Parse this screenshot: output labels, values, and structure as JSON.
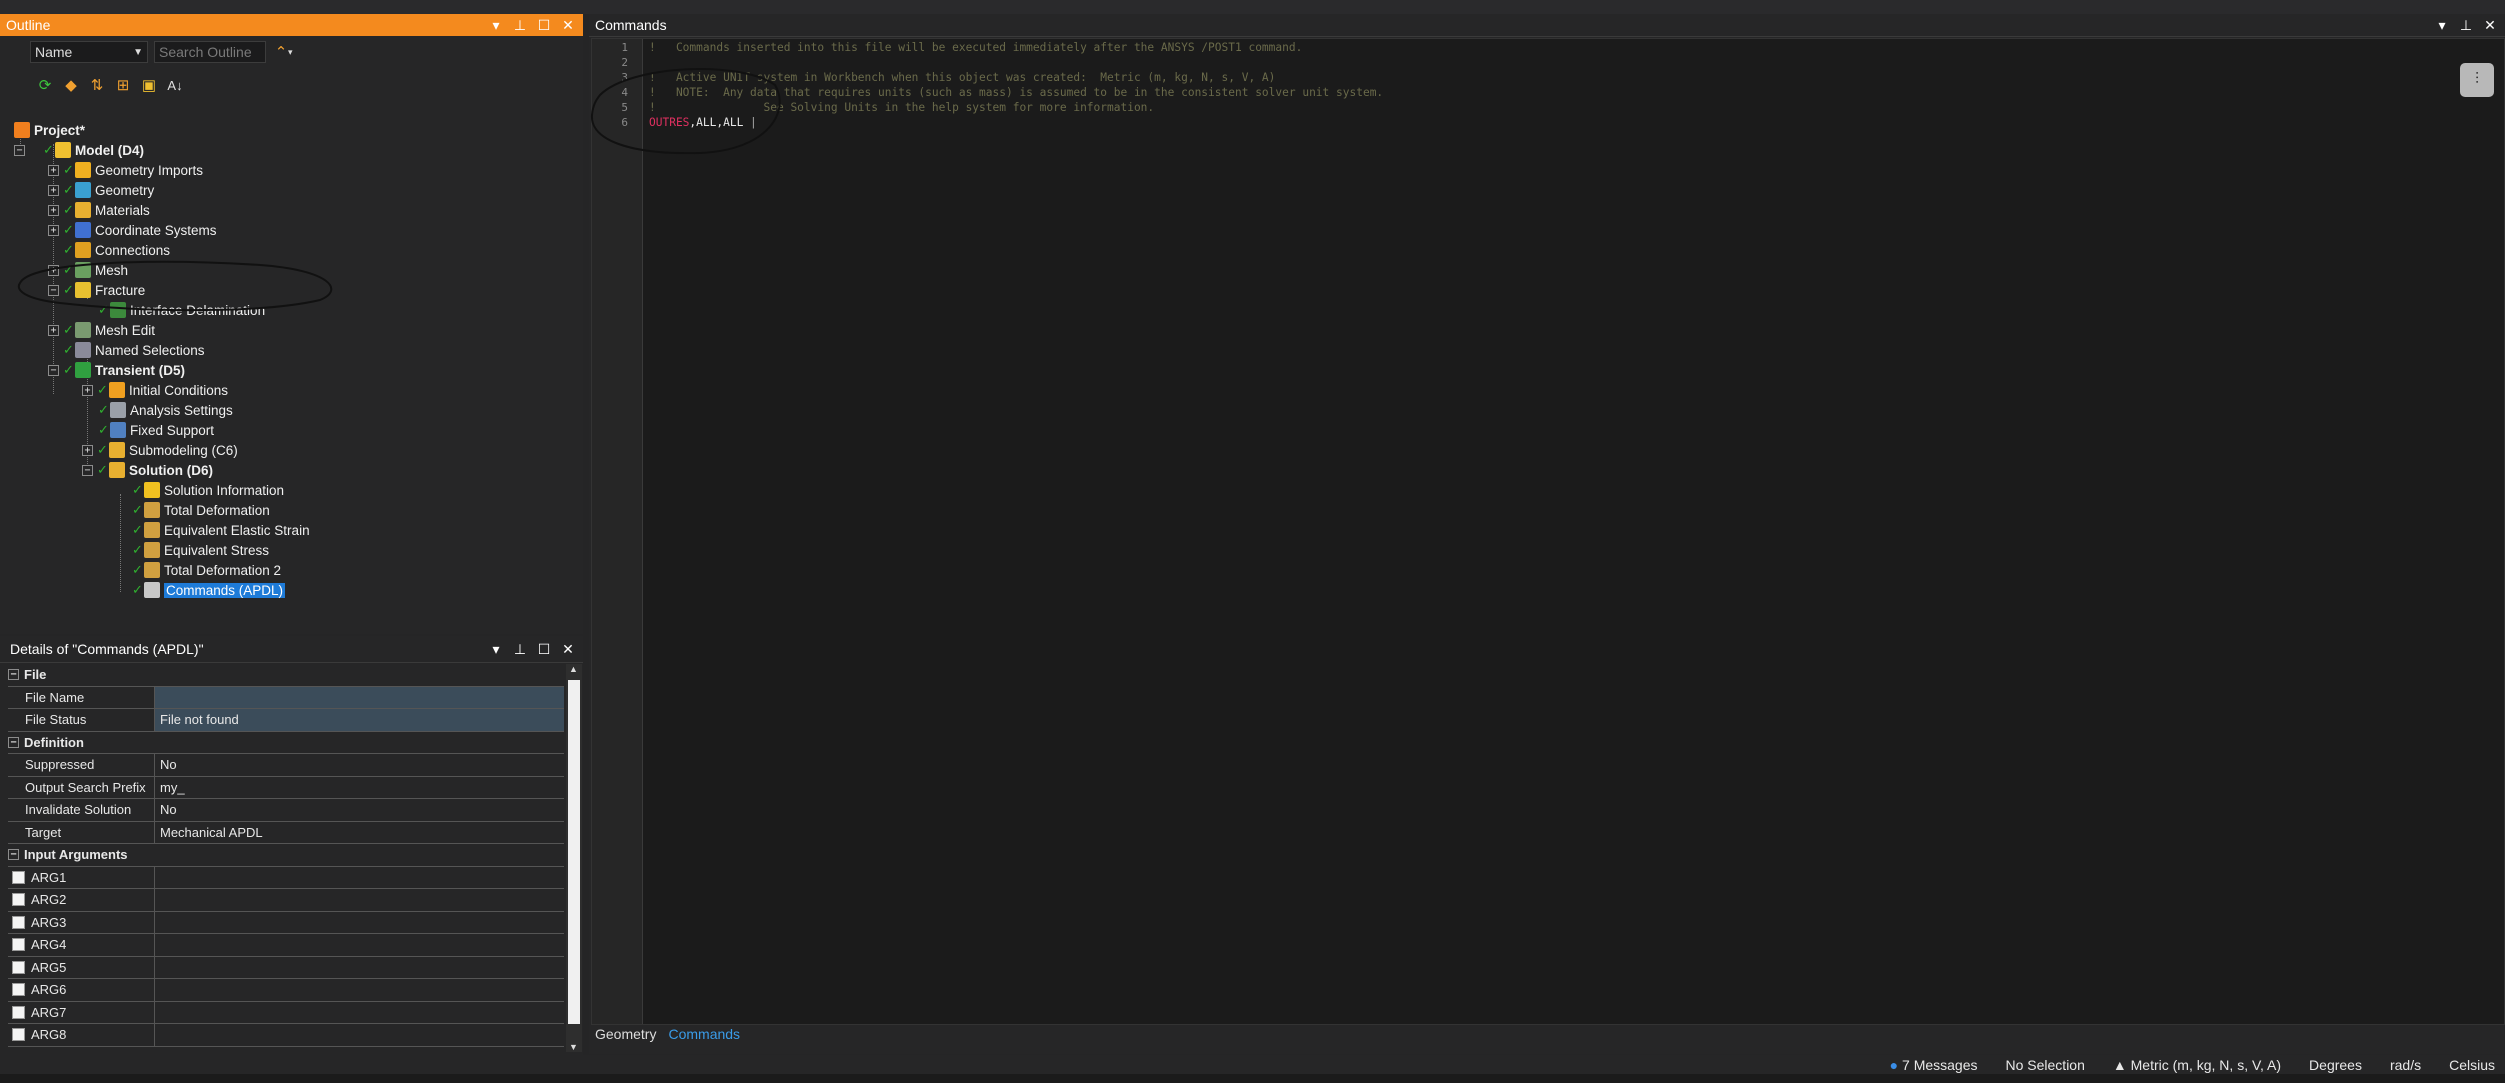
{
  "outline": {
    "title": "Outline",
    "name_combo": "Name",
    "search_placeholder": "Search Outline",
    "tree": {
      "project": "Project*",
      "model": "Model (D4)",
      "geometry_imports": "Geometry Imports",
      "geometry": "Geometry",
      "materials": "Materials",
      "coordinate_systems": "Coordinate Systems",
      "connections": "Connections",
      "mesh": "Mesh",
      "fracture": "Fracture",
      "interface_delamination": "Interface Delamination",
      "mesh_edit": "Mesh Edit",
      "named_selections": "Named Selections",
      "transient": "Transient (D5)",
      "initial_conditions": "Initial Conditions",
      "analysis_settings": "Analysis Settings",
      "fixed_support": "Fixed Support",
      "submodeling": "Submodeling (C6)",
      "solution": "Solution (D6)",
      "solution_information": "Solution Information",
      "total_deformation": "Total Deformation",
      "equivalent_elastic_strain": "Equivalent Elastic Strain",
      "equivalent_stress": "Equivalent Stress",
      "total_deformation_2": "Total Deformation 2",
      "commands_apdl": "Commands (APDL)"
    }
  },
  "details": {
    "title": "Details of \"Commands (APDL)\"",
    "sections": {
      "file": "File",
      "definition": "Definition",
      "input_arguments": "Input Arguments"
    },
    "rows": {
      "file_name_label": "File Name",
      "file_name_value": "",
      "file_status_label": "File Status",
      "file_status_value": "File not found",
      "suppressed_label": "Suppressed",
      "suppressed_value": "No",
      "output_prefix_label": "Output Search Prefix",
      "output_prefix_value": "my_",
      "invalidate_label": "Invalidate Solution",
      "invalidate_value": "No",
      "target_label": "Target",
      "target_value": "Mechanical APDL"
    },
    "args": [
      "ARG1",
      "ARG2",
      "ARG3",
      "ARG4",
      "ARG5",
      "ARG6",
      "ARG7",
      "ARG8"
    ]
  },
  "commands": {
    "title": "Commands",
    "lines": {
      "n1": "1",
      "n2": "2",
      "n3": "3",
      "n4": "4",
      "n5": "5",
      "n6": "6",
      "l1": "!   Commands inserted into this file will be executed immediately after the ANSYS /POST1 command.",
      "l3": "!   Active UNIT system in Workbench when this object was created:  Metric (m, kg, N, s, V, A)",
      "l4": "!   NOTE:  Any data that requires units (such as mass) is assumed to be in the consistent solver unit system.",
      "l5": "!                See Solving Units in the help system for more information.",
      "l6_kw": "OUTRES",
      "l6_rest": ",ALL,ALL"
    },
    "tabs": {
      "geometry": "Geometry",
      "commands": "Commands"
    }
  },
  "status": {
    "messages": "7 Messages",
    "selection": "No Selection",
    "units": "Metric (m, kg, N, s, V, A)",
    "angle": "Degrees",
    "rotation": "rad/s",
    "temperature": "Celsius"
  },
  "colors": {
    "accent": "#f48a1e",
    "selection": "#1e7bd8",
    "check": "#2fb02f",
    "keyword": "#e03060"
  }
}
